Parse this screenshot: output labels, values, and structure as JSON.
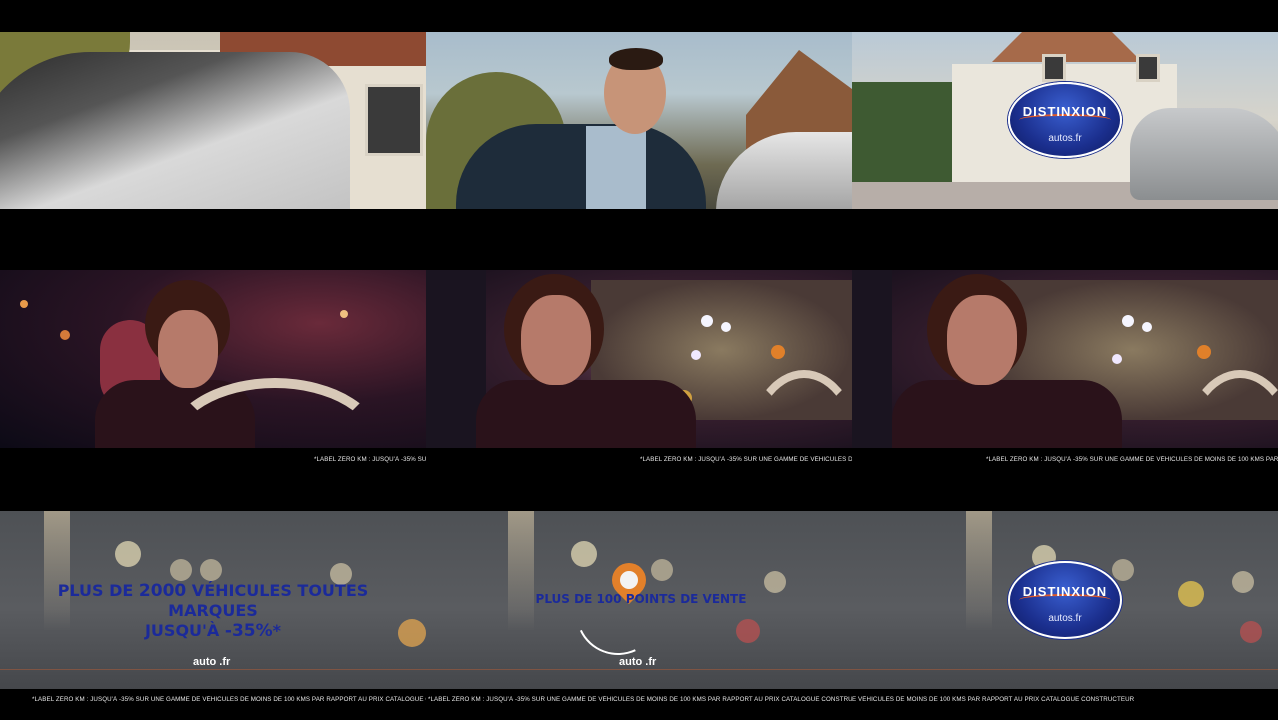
{
  "disclaimer": {
    "short": "*LABEL ZÉRO KM : JUSQU'À -35% SUR UN",
    "medium": "*LABEL ZÉRO KM : JUSQU'À -35% SUR UNE GAMME DE VÉHICULES DE MOINS",
    "long": "*LABEL ZÉRO KM : JUSQU'À -35% SUR UNE GAMME DE VÉHICULES DE MOINS DE 100 KMS PAR RAPPORT",
    "full": "*LABEL ZÉRO KM : JUSQU'À -35% SUR UNE GAMME DE VÉHICULES DE MOINS DE 100 KMS PAR RAPPORT AU PRIX CATALOGUE CONSTRUCTEUR",
    "tail": "E VÉHICULES DE MOINS DE 100 KMS PAR RAPPORT AU PRIX CATALOGUE CONSTRUCTEUR"
  },
  "logo": {
    "brand": "DISTINXION",
    "sub": "autos.fr",
    "color_primary": "#1b2f8e",
    "color_accent": "#e05a2a"
  },
  "promo": {
    "line1_pre": "PLUS DE ",
    "line1_number": "2000",
    "line1_post": " VÉHICULES TOUTES MARQUES",
    "line2_pre": "JUSQU'À ",
    "line2_value": "-35%",
    "line2_post": "*",
    "points": "PLUS DE 100 POINTS DE VENTE"
  },
  "small_logo": {
    "text_a": "auto",
    "text_b": ".fr"
  }
}
